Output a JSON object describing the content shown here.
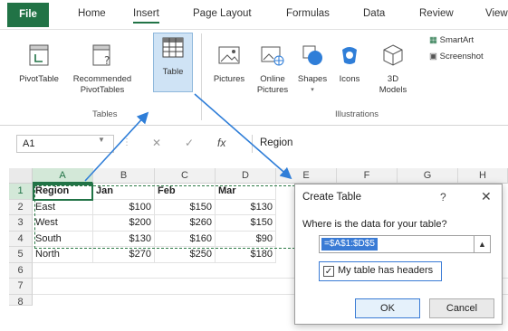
{
  "tabs": [
    "File",
    "Home",
    "Insert",
    "Page Layout",
    "Formulas",
    "Data",
    "Review",
    "View"
  ],
  "ribbon": {
    "pivottable": "PivotTable",
    "recommended": "Recommended PivotTables",
    "table": "Table",
    "pictures": "Pictures",
    "online_pictures": "Online Pictures",
    "shapes": "Shapes",
    "icons": "Icons",
    "models": "3D Models",
    "smartart": "SmartArt",
    "screenshot": "Screenshot",
    "group_tables": "Tables",
    "group_illustrations": "Illustrations"
  },
  "formula_bar": {
    "name_box": "A1",
    "fx": "fx",
    "content": "Region"
  },
  "grid": {
    "columns": [
      "A",
      "B",
      "C",
      "D",
      "E",
      "F",
      "G",
      "H"
    ],
    "rows": [
      "1",
      "2",
      "3",
      "4",
      "5",
      "6",
      "7",
      "8"
    ],
    "data": [
      [
        "Region",
        "Jan",
        "Feb",
        "Mar"
      ],
      [
        "East",
        "$100",
        "$150",
        "$130"
      ],
      [
        "West",
        "$200",
        "$260",
        "$150"
      ],
      [
        "South",
        "$130",
        "$160",
        "$90"
      ],
      [
        "North",
        "$270",
        "$250",
        "$180"
      ]
    ]
  },
  "dialog": {
    "title": "Create Table",
    "help": "?",
    "close": "✕",
    "prompt": "Where is the data for your table?",
    "range": "=$A$1:$D$5",
    "checkbox_label": "My table has headers",
    "ok": "OK",
    "cancel": "Cancel"
  },
  "colors": {
    "excel_green": "#217346",
    "highlight_blue": "#3a7bd5",
    "arrow_blue": "#2f7ed8"
  }
}
